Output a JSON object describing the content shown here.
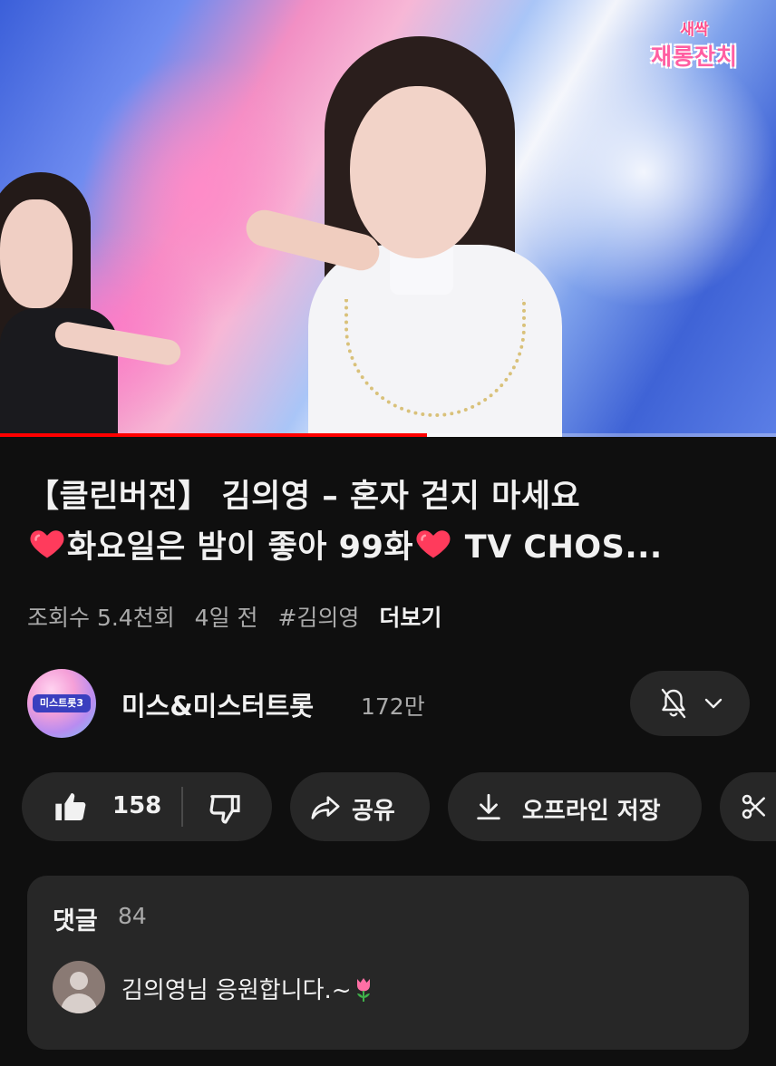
{
  "video": {
    "overlay_logo_top": "새싹",
    "overlay_logo_bottom": "재롱잔치",
    "progress_fraction": 0.55
  },
  "title": {
    "line1": "【클린버전】 김의영 – 혼자 걷지 마세요",
    "line2_part1": "화요일은 밤이 좋아 99화",
    "line2_part2": " TV CHOS...",
    "emoji": "heart"
  },
  "meta": {
    "views": "조회수 5.4천회",
    "age": "4일 전",
    "hashtag": "#김의영",
    "more": "더보기"
  },
  "channel": {
    "avatar_tag": "미스트롯3",
    "name": "미스&미스터트롯",
    "subscribers": "172만",
    "bell_icon": "bell-off-icon",
    "chevron_icon": "chevron-down-icon"
  },
  "actions": {
    "like_count": "158",
    "share_label": "공유",
    "offline_label": "오프라인 저장",
    "clip_icon": "scissors-icon"
  },
  "comments": {
    "header": "댓글",
    "count": "84",
    "top_comment": "김의영님 응원합니다.~"
  },
  "colors": {
    "background": "#0f0f0f",
    "pill": "#272727",
    "secondary_text": "#aaaaaa",
    "progress": "#ff0000"
  }
}
